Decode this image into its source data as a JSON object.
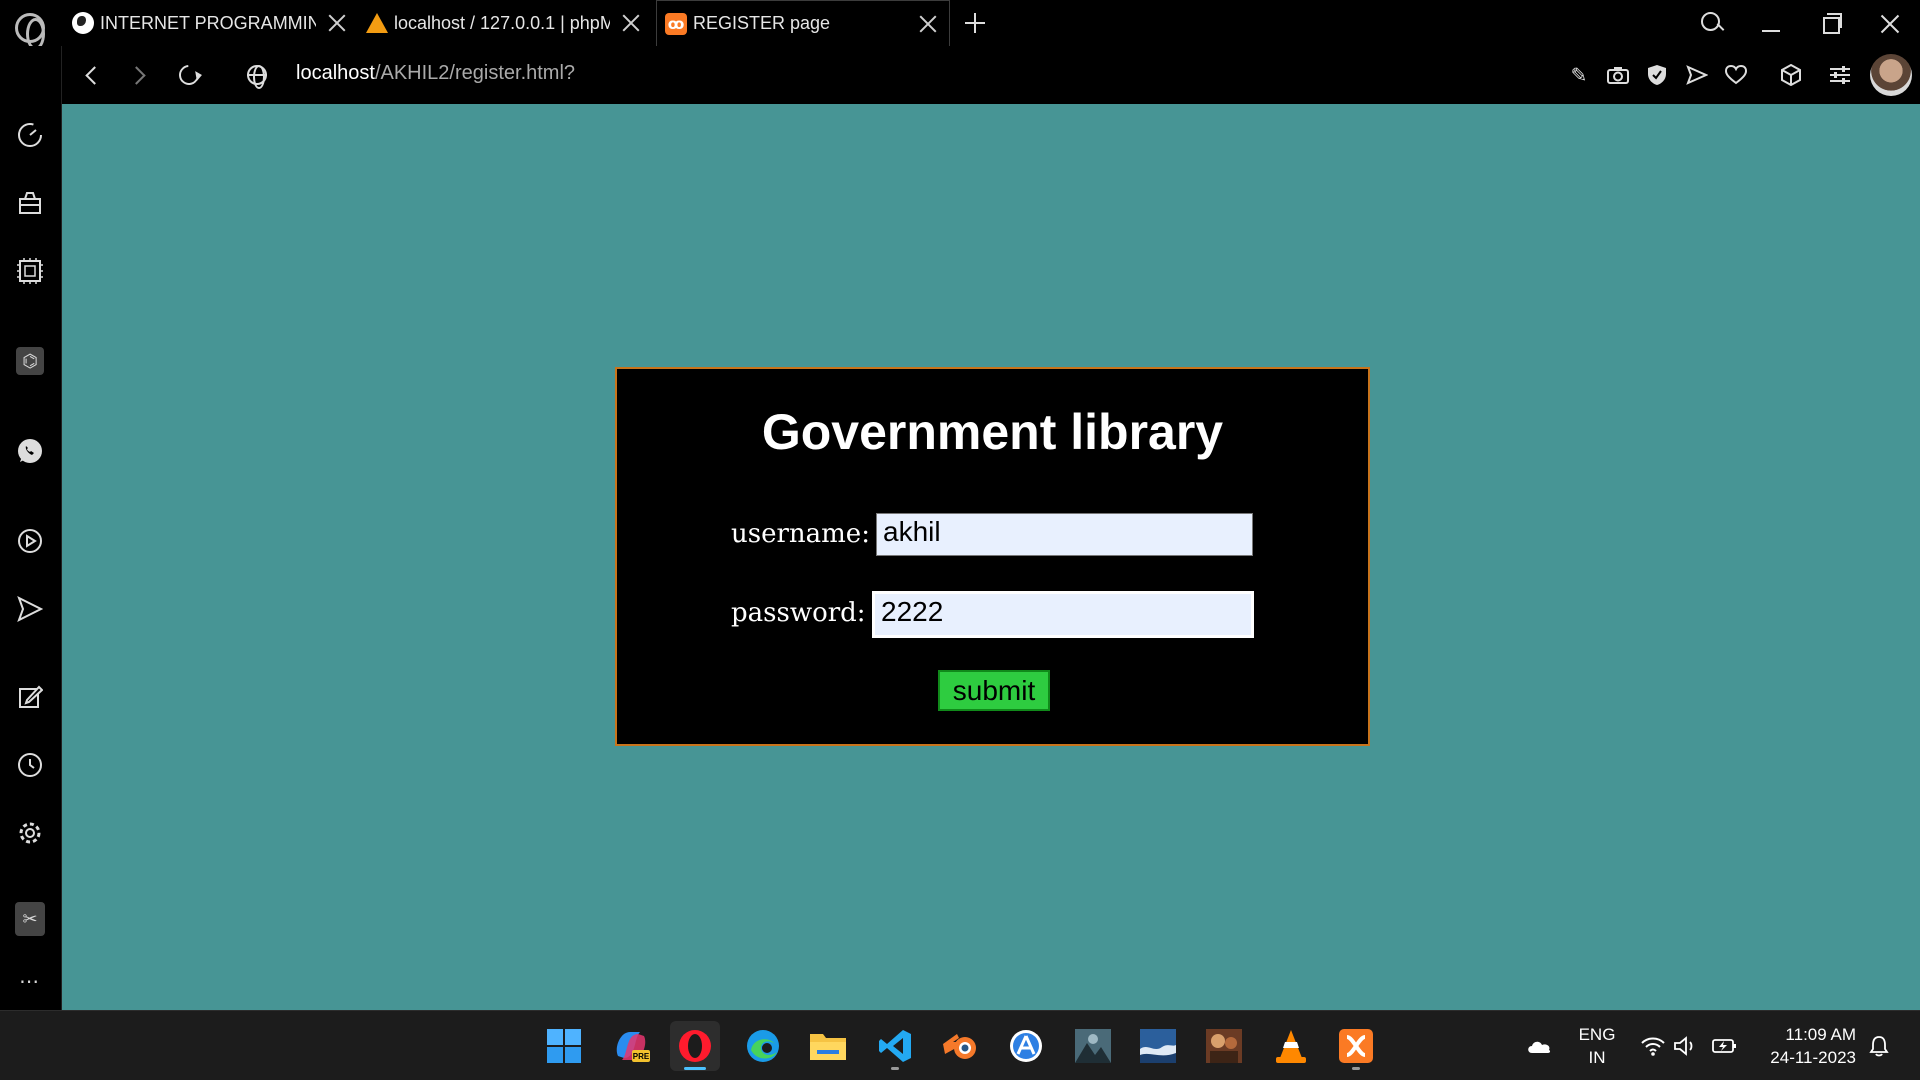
{
  "tabs": [
    {
      "title": "INTERNET PROGRAMMING",
      "favicon": "globe-favicon"
    },
    {
      "title": "localhost / 127.0.0.1 | phpM",
      "favicon": "phpmyadmin-favicon"
    },
    {
      "title": "REGISTER page",
      "favicon": "xampp-favicon",
      "active": true
    }
  ],
  "address": {
    "host": "localhost",
    "path": "/AKHIL2/register.html?"
  },
  "page": {
    "heading": "Government library",
    "username_label": "username:",
    "username_value": "akhil",
    "password_label": "password:",
    "password_value": "2222",
    "submit_label": "submit",
    "background_color": "#479595",
    "card_border_color": "#c8741c",
    "button_color": "#2ecc40"
  },
  "taskbar": {
    "language": "ENG",
    "region": "IN",
    "time": "11:09 AM",
    "date": "24-11-2023",
    "apps": [
      "windows-start",
      "copilot-pre",
      "opera",
      "edge",
      "file-explorer",
      "vscode",
      "blender",
      "app-store",
      "photo-1",
      "photo-2",
      "photo-3",
      "vlc",
      "xampp"
    ]
  }
}
